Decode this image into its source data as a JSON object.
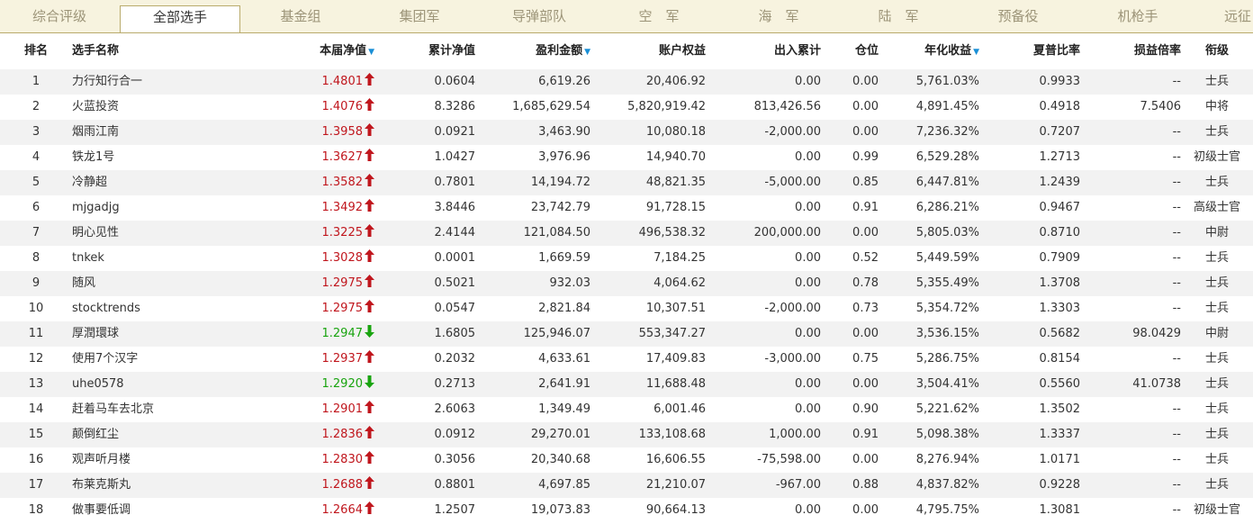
{
  "tabs": [
    {
      "label": "综合评级"
    },
    {
      "label": "全部选手"
    },
    {
      "label": "基金组"
    },
    {
      "label": "集团军"
    },
    {
      "label": "导弹部队"
    },
    {
      "label": "空　军"
    },
    {
      "label": "海　军"
    },
    {
      "label": "陆　军"
    },
    {
      "label": "预备役"
    },
    {
      "label": "机枪手"
    },
    {
      "label": "远征"
    }
  ],
  "active_tab": 1,
  "columns": {
    "rank": "排名",
    "name": "选手名称",
    "nav": "本届净值",
    "cum_nav": "累计净值",
    "profit": "盈利金额",
    "equity": "账户权益",
    "flow": "出入累计",
    "position": "仓位",
    "annual": "年化收益",
    "sharpe": "夏普比率",
    "pl_ratio": "损益倍率",
    "rank_title": "衔级"
  },
  "sort_indicator": "▼",
  "colors": {
    "up": "#c0161d",
    "down": "#19a40f",
    "tab_border": "#b9ab6c",
    "tab_bg": "#f7f3df",
    "sort": "#1a8fd6"
  },
  "rows": [
    {
      "rank": "1",
      "name": "力行知行合一",
      "nav": "1.4801",
      "trend": "up",
      "cum_nav": "0.0604",
      "profit": "6,619.26",
      "equity": "20,406.92",
      "flow": "0.00",
      "position": "0.00",
      "annual": "5,761.03%",
      "sharpe": "0.9933",
      "pl_ratio": "--",
      "title": "士兵"
    },
    {
      "rank": "2",
      "name": "火蓝投资",
      "nav": "1.4076",
      "trend": "up",
      "cum_nav": "8.3286",
      "profit": "1,685,629.54",
      "equity": "5,820,919.42",
      "flow": "813,426.56",
      "position": "0.00",
      "annual": "4,891.45%",
      "sharpe": "0.4918",
      "pl_ratio": "7.5406",
      "title": "中将"
    },
    {
      "rank": "3",
      "name": "烟雨江南",
      "nav": "1.3958",
      "trend": "up",
      "cum_nav": "0.0921",
      "profit": "3,463.90",
      "equity": "10,080.18",
      "flow": "-2,000.00",
      "position": "0.00",
      "annual": "7,236.32%",
      "sharpe": "0.7207",
      "pl_ratio": "--",
      "title": "士兵"
    },
    {
      "rank": "4",
      "name": "铁龙1号",
      "nav": "1.3627",
      "trend": "up",
      "cum_nav": "1.0427",
      "profit": "3,976.96",
      "equity": "14,940.70",
      "flow": "0.00",
      "position": "0.99",
      "annual": "6,529.28%",
      "sharpe": "1.2713",
      "pl_ratio": "--",
      "title": "初级士官"
    },
    {
      "rank": "5",
      "name": "冷静超",
      "nav": "1.3582",
      "trend": "up",
      "cum_nav": "0.7801",
      "profit": "14,194.72",
      "equity": "48,821.35",
      "flow": "-5,000.00",
      "position": "0.85",
      "annual": "6,447.81%",
      "sharpe": "1.2439",
      "pl_ratio": "--",
      "title": "士兵"
    },
    {
      "rank": "6",
      "name": "mjgadjg",
      "nav": "1.3492",
      "trend": "up",
      "cum_nav": "3.8446",
      "profit": "23,742.79",
      "equity": "91,728.15",
      "flow": "0.00",
      "position": "0.91",
      "annual": "6,286.21%",
      "sharpe": "0.9467",
      "pl_ratio": "--",
      "title": "高级士官"
    },
    {
      "rank": "7",
      "name": "明心见性",
      "nav": "1.3225",
      "trend": "up",
      "cum_nav": "2.4144",
      "profit": "121,084.50",
      "equity": "496,538.32",
      "flow": "200,000.00",
      "position": "0.00",
      "annual": "5,805.03%",
      "sharpe": "0.8710",
      "pl_ratio": "--",
      "title": "中尉"
    },
    {
      "rank": "8",
      "name": "tnkek",
      "nav": "1.3028",
      "trend": "up",
      "cum_nav": "0.0001",
      "profit": "1,669.59",
      "equity": "7,184.25",
      "flow": "0.00",
      "position": "0.52",
      "annual": "5,449.59%",
      "sharpe": "0.7909",
      "pl_ratio": "--",
      "title": "士兵"
    },
    {
      "rank": "9",
      "name": "随风",
      "nav": "1.2975",
      "trend": "up",
      "cum_nav": "0.5021",
      "profit": "932.03",
      "equity": "4,064.62",
      "flow": "0.00",
      "position": "0.78",
      "annual": "5,355.49%",
      "sharpe": "1.3708",
      "pl_ratio": "--",
      "title": "士兵"
    },
    {
      "rank": "10",
      "name": "stocktrends",
      "nav": "1.2975",
      "trend": "up",
      "cum_nav": "0.0547",
      "profit": "2,821.84",
      "equity": "10,307.51",
      "flow": "-2,000.00",
      "position": "0.73",
      "annual": "5,354.72%",
      "sharpe": "1.3303",
      "pl_ratio": "--",
      "title": "士兵"
    },
    {
      "rank": "11",
      "name": "厚潤環球",
      "nav": "1.2947",
      "trend": "down",
      "cum_nav": "1.6805",
      "profit": "125,946.07",
      "equity": "553,347.27",
      "flow": "0.00",
      "position": "0.00",
      "annual": "3,536.15%",
      "sharpe": "0.5682",
      "pl_ratio": "98.0429",
      "title": "中尉"
    },
    {
      "rank": "12",
      "name": "使用7个汉字",
      "nav": "1.2937",
      "trend": "up",
      "cum_nav": "0.2032",
      "profit": "4,633.61",
      "equity": "17,409.83",
      "flow": "-3,000.00",
      "position": "0.75",
      "annual": "5,286.75%",
      "sharpe": "0.8154",
      "pl_ratio": "--",
      "title": "士兵"
    },
    {
      "rank": "13",
      "name": "uhe0578",
      "nav": "1.2920",
      "trend": "down",
      "cum_nav": "0.2713",
      "profit": "2,641.91",
      "equity": "11,688.48",
      "flow": "0.00",
      "position": "0.00",
      "annual": "3,504.41%",
      "sharpe": "0.5560",
      "pl_ratio": "41.0738",
      "title": "士兵"
    },
    {
      "rank": "14",
      "name": "赶着马车去北京",
      "nav": "1.2901",
      "trend": "up",
      "cum_nav": "2.6063",
      "profit": "1,349.49",
      "equity": "6,001.46",
      "flow": "0.00",
      "position": "0.90",
      "annual": "5,221.62%",
      "sharpe": "1.3502",
      "pl_ratio": "--",
      "title": "士兵"
    },
    {
      "rank": "15",
      "name": "颠倒红尘",
      "nav": "1.2836",
      "trend": "up",
      "cum_nav": "0.0912",
      "profit": "29,270.01",
      "equity": "133,108.68",
      "flow": "1,000.00",
      "position": "0.91",
      "annual": "5,098.38%",
      "sharpe": "1.3337",
      "pl_ratio": "--",
      "title": "士兵"
    },
    {
      "rank": "16",
      "name": "观声听月楼",
      "nav": "1.2830",
      "trend": "up",
      "cum_nav": "0.3056",
      "profit": "20,340.68",
      "equity": "16,606.55",
      "flow": "-75,598.00",
      "position": "0.00",
      "annual": "8,276.94%",
      "sharpe": "1.0171",
      "pl_ratio": "--",
      "title": "士兵"
    },
    {
      "rank": "17",
      "name": "布莱克斯丸",
      "nav": "1.2688",
      "trend": "up",
      "cum_nav": "0.8801",
      "profit": "4,697.85",
      "equity": "21,210.07",
      "flow": "-967.00",
      "position": "0.88",
      "annual": "4,837.82%",
      "sharpe": "0.9228",
      "pl_ratio": "--",
      "title": "士兵"
    },
    {
      "rank": "18",
      "name": "做事要低调",
      "nav": "1.2664",
      "trend": "up",
      "cum_nav": "1.2507",
      "profit": "19,073.83",
      "equity": "90,664.13",
      "flow": "0.00",
      "position": "0.00",
      "annual": "4,795.75%",
      "sharpe": "1.3081",
      "pl_ratio": "--",
      "title": "初级士官"
    }
  ]
}
